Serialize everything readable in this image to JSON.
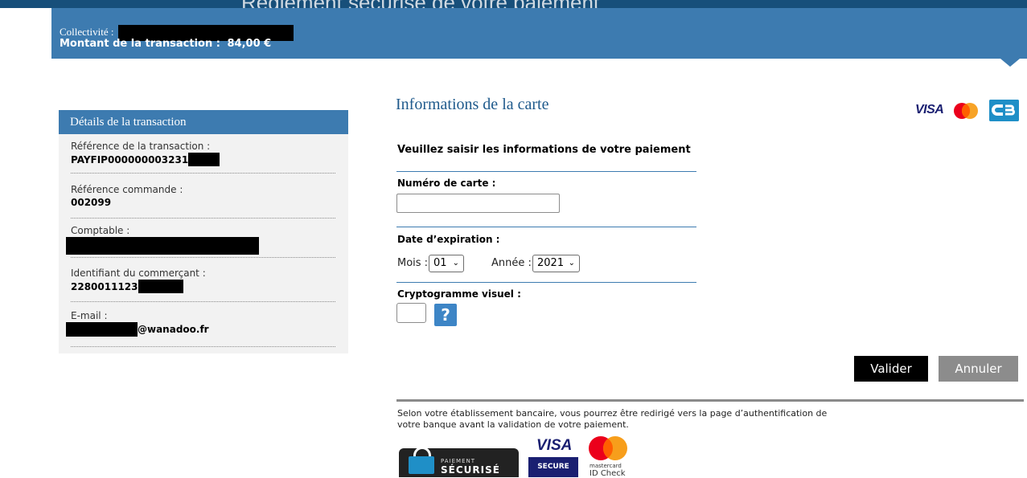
{
  "top_strip_text": "Règlement sécurisé de votre paiement",
  "header": {
    "collectivity_label": "Collectivité :",
    "amount_label": "Montant de la transaction :",
    "amount_value": "84,00 €"
  },
  "details": {
    "title": "Détails de la transaction",
    "items": [
      {
        "label": "Référence de la transaction :",
        "value": "PAYFIP000000003231"
      },
      {
        "label": "Référence commande :",
        "value": "002099"
      },
      {
        "label": "Comptable :",
        "value": ""
      },
      {
        "label": "Identifiant du commerçant :",
        "value": "2280011123"
      },
      {
        "label": "E-mail :",
        "value": "@wanadoo.fr"
      }
    ]
  },
  "card_form": {
    "title": "Informations de la carte",
    "subtitle": "Veuillez saisir les informations de votre paiement",
    "card_number_label": "Numéro de carte :",
    "card_number_value": "",
    "expiry_label": "Date d’expiration :",
    "month_label": "Mois :",
    "month_value": "01",
    "year_label": "Année :",
    "year_value": "2021",
    "cvv_label": "Cryptogramme visuel :",
    "cvv_value": "",
    "help_symbol": "?"
  },
  "actions": {
    "validate_label": "Valider",
    "cancel_label": "Annuler"
  },
  "notice": "Selon votre établissement bancaire, vous pourrez être redirigé vers la page d’authentification de votre banque avant la validation de votre paiement.",
  "logos": {
    "visa_text": "VISA",
    "badge_cb_line1": "PAIEMENT",
    "badge_cb_line2": "SÉCURISÉ",
    "badge_visa_text": "VISA",
    "badge_visa_secure": "SECURE",
    "badge_mc_line1": "mastercard",
    "badge_mc_line2": "ID Check"
  },
  "colors": {
    "header_blue": "#3d7bb0",
    "title_blue": "#1f5a8c",
    "validate_bg": "#000000",
    "cancel_bg": "#8c8c8c"
  }
}
